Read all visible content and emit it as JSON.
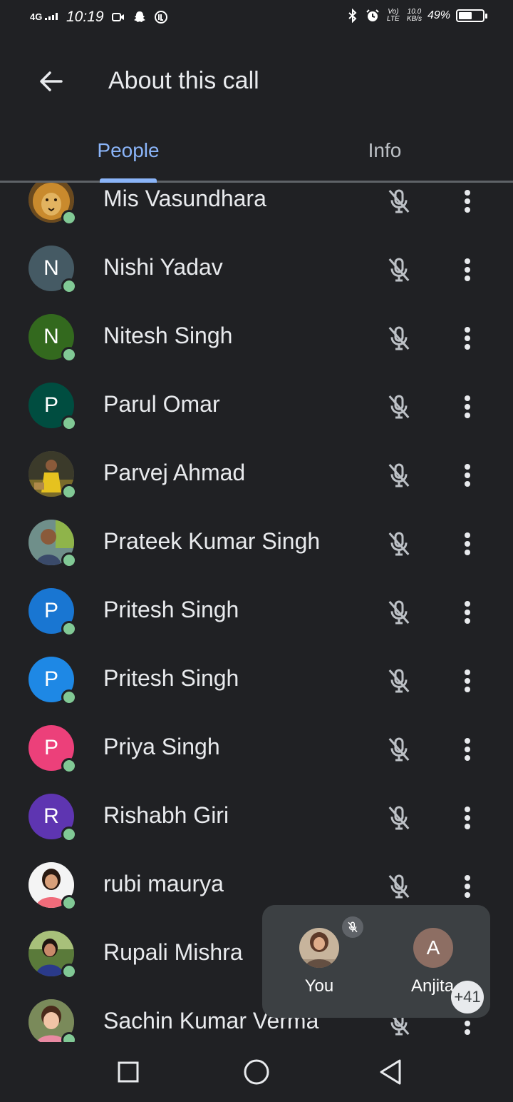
{
  "status_bar": {
    "network": "4G",
    "time": "10:19",
    "volte_label": "Vo) LTE",
    "speed_value": "10.0",
    "speed_unit": "KB/s",
    "battery_percent": "49%",
    "battery_level": 0.49
  },
  "app_bar": {
    "title": "About this call"
  },
  "tabs": [
    {
      "label": "People",
      "selected": true
    },
    {
      "label": "Info",
      "selected": false
    }
  ],
  "participants": [
    {
      "name": "Mis Vasundhara",
      "avatar_type": "photo",
      "photo_theme": "lion"
    },
    {
      "name": "Nishi Yadav",
      "avatar_type": "initial",
      "initial": "N",
      "color": "#455a64"
    },
    {
      "name": "Nitesh Singh",
      "avatar_type": "initial",
      "initial": "N",
      "color": "#33691e"
    },
    {
      "name": "Parul Omar",
      "avatar_type": "initial",
      "initial": "P",
      "color": "#004d40"
    },
    {
      "name": "Parvej Ahmad",
      "avatar_type": "photo",
      "photo_theme": "person-yellow"
    },
    {
      "name": "Prateek Kumar Singh",
      "avatar_type": "photo",
      "photo_theme": "person-outdoor"
    },
    {
      "name": "Pritesh Singh",
      "avatar_type": "initial",
      "initial": "P",
      "color": "#1976d2"
    },
    {
      "name": "Pritesh Singh",
      "avatar_type": "initial",
      "initial": "P",
      "color": "#1e88e5"
    },
    {
      "name": "Priya Singh",
      "avatar_type": "initial",
      "initial": "P",
      "color": "#ec407a"
    },
    {
      "name": "Rishabh Giri",
      "avatar_type": "initial",
      "initial": "R",
      "color": "#5e35b1"
    },
    {
      "name": "rubi maurya",
      "avatar_type": "photo",
      "photo_theme": "person-pink"
    },
    {
      "name": "Rupali Mishra",
      "avatar_type": "photo",
      "photo_theme": "person-garden"
    },
    {
      "name": "Sachin Kumar Verma",
      "avatar_type": "photo",
      "photo_theme": "person-child"
    }
  ],
  "floating_panel": {
    "self_label": "You",
    "other_initial": "A",
    "other_label": "Anjita",
    "more_count": "+41"
  },
  "colors": {
    "background": "#202124",
    "accent": "#8ab4f8",
    "online": "#81c995"
  }
}
